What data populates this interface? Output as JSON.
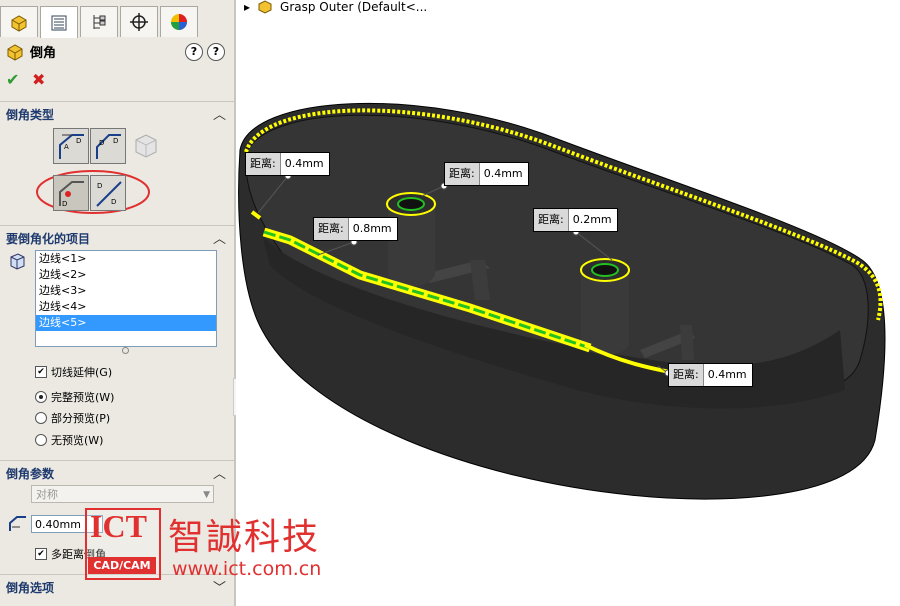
{
  "tabs": [
    "feature-manager",
    "property-manager",
    "configuration-manager",
    "dimxpert-manager",
    "display-manager"
  ],
  "feature": {
    "title": "倒角",
    "help": "?"
  },
  "sections": {
    "chamfer_type": "倒角类型",
    "items_to_chamfer": "要倒角化的项目",
    "chamfer_params": "倒角参数",
    "chamfer_options": "倒角选项"
  },
  "edges": [
    "边线<1>",
    "边线<2>",
    "边线<3>",
    "边线<4>",
    "边线<5>"
  ],
  "selected_edge_index": 4,
  "options": {
    "tangent_propagation": "切线延伸(G)",
    "full_preview": "完整预览(W)",
    "partial_preview": "部分预览(P)",
    "no_preview": "无预览(W)",
    "multi_distance": "多距离倒角"
  },
  "params": {
    "mode": "对称",
    "distance": "0.40mm"
  },
  "tree_item": "Grasp Outer  (Default<...",
  "callouts": [
    {
      "key": "距离:",
      "value": "0.4mm"
    },
    {
      "key": "距离:",
      "value": "0.4mm"
    },
    {
      "key": "距离:",
      "value": "0.8mm"
    },
    {
      "key": "距离:",
      "value": "0.2mm"
    },
    {
      "key": "距离:",
      "value": "0.4mm"
    }
  ],
  "watermark": {
    "logo": "ICT",
    "sub": "CAD/CAM",
    "name": "智誠科技",
    "url": "www.ict.com.cn"
  },
  "colors": {
    "accent": "#e03030",
    "highlight": "#ffff00",
    "selection": "#3399ff",
    "part": "#2f2f2f"
  }
}
